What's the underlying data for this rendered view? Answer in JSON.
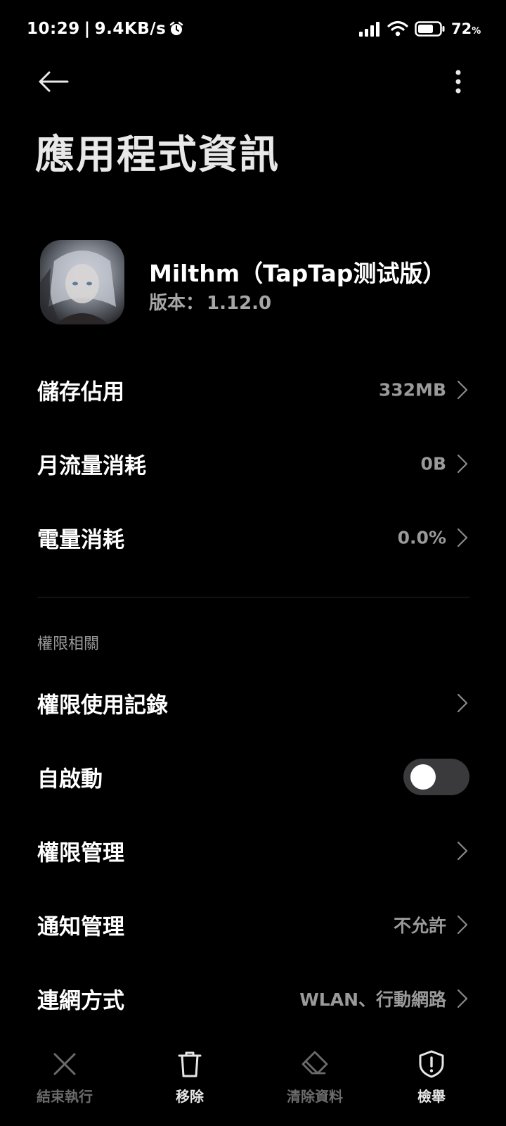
{
  "status_bar": {
    "time": "10:29",
    "separator": "|",
    "net_speed": "9.4KB/s",
    "battery_percent": "72",
    "battery_unit": "%",
    "battery_level": 0.72,
    "icons": [
      "alarm-icon",
      "signal-icon",
      "wifi-icon",
      "battery-icon"
    ]
  },
  "header": {
    "back_icon": "arrow-left-icon",
    "more_icon": "more-vertical-icon",
    "title": "應用程式資訊"
  },
  "app": {
    "name": "Milthm（TapTap测试版）",
    "version_label": "版本：",
    "version_value": "1.12.0"
  },
  "usage_rows": [
    {
      "label": "儲存佔用",
      "value": "332MB"
    },
    {
      "label": "月流量消耗",
      "value": "0B"
    },
    {
      "label": "電量消耗",
      "value": "0.0%"
    }
  ],
  "permissions_section": {
    "header": "權限相關",
    "rows": [
      {
        "label": "權限使用記錄",
        "value": ""
      },
      {
        "label": "自啟動",
        "toggle": false
      },
      {
        "label": "權限管理",
        "value": ""
      },
      {
        "label": "通知管理",
        "value": "不允許"
      },
      {
        "label": "連網方式",
        "value": "WLAN、行動網路"
      }
    ]
  },
  "bottom_actions": [
    {
      "label": "結束執行",
      "icon": "close-icon",
      "enabled": false
    },
    {
      "label": "移除",
      "icon": "trash-icon",
      "enabled": true
    },
    {
      "label": "清除資料",
      "icon": "eraser-icon",
      "enabled": false
    },
    {
      "label": "檢舉",
      "icon": "shield-alert-icon",
      "enabled": true
    }
  ],
  "colors": {
    "background": "#000000",
    "primary_text": "#ffffff",
    "secondary_text": "#9a9a9a",
    "disabled_text": "#6b6b6b",
    "toggle_off_track": "#3a3a3c"
  }
}
